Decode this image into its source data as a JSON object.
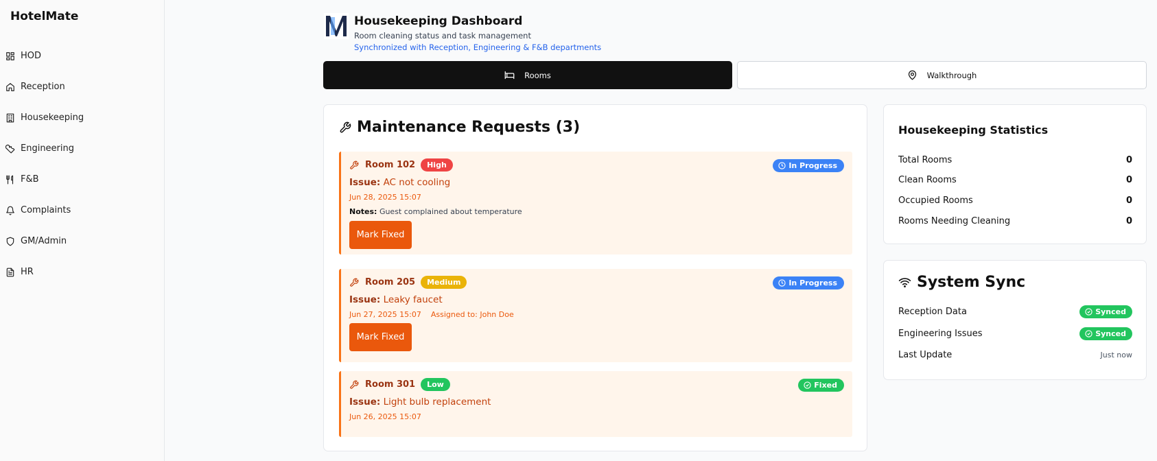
{
  "app": {
    "brand": "HotelMate"
  },
  "sidebar": {
    "items": [
      {
        "label": "HOD",
        "icon": "grid-icon"
      },
      {
        "label": "Reception",
        "icon": "home-icon"
      },
      {
        "label": "Housekeeping",
        "icon": "building-icon"
      },
      {
        "label": "Engineering",
        "icon": "wrench-icon"
      },
      {
        "label": "F&B",
        "icon": "utensils-icon"
      },
      {
        "label": "Complaints",
        "icon": "bell-icon"
      },
      {
        "label": "GM/Admin",
        "icon": "shield-icon"
      },
      {
        "label": "HR",
        "icon": "document-icon"
      }
    ]
  },
  "header": {
    "title": "Housekeeping Dashboard",
    "subtitle": "Room cleaning status and task management",
    "sync_note": "Synchronized with Reception, Engineering & F&B departments"
  },
  "tabs": [
    {
      "label": "Rooms",
      "icon": "bed-icon",
      "active": true
    },
    {
      "label": "Walkthrough",
      "icon": "map-pin-icon",
      "active": false
    }
  ],
  "maintenance": {
    "title": "Maintenance Requests (3)",
    "issue_label": "Issue:",
    "notes_label": "Notes:",
    "fix_label": "Mark Fixed",
    "requests": [
      {
        "room": "Room 102",
        "priority": "High",
        "priority_color": "#ef4444",
        "status": "In Progress",
        "status_color": "#3b82f6",
        "issue": "AC not cooling",
        "date": "Jun 28, 2025 15:07",
        "notes": "Guest complained about temperature"
      },
      {
        "room": "Room 205",
        "priority": "Medium",
        "priority_color": "#eab308",
        "status": "In Progress",
        "status_color": "#3b82f6",
        "issue": "Leaky faucet",
        "date": "Jun 27, 2025 15:07",
        "assigned": "Assigned to: John Doe"
      },
      {
        "room": "Room 301",
        "priority": "Low",
        "priority_color": "#22c55e",
        "status": "Fixed",
        "status_color": "#22c55e",
        "issue": "Light bulb replacement",
        "date": "Jun 26, 2025 15:07"
      }
    ]
  },
  "stats": {
    "title": "Housekeeping Statistics",
    "rows": [
      {
        "label": "Total Rooms",
        "value": "0"
      },
      {
        "label": "Clean Rooms",
        "value": "0"
      },
      {
        "label": "Occupied Rooms",
        "value": "0"
      },
      {
        "label": "Rooms Needing Cleaning",
        "value": "0"
      }
    ]
  },
  "system_sync": {
    "title": "System Sync",
    "rows": [
      {
        "label": "Reception Data",
        "value": "Synced"
      },
      {
        "label": "Engineering Issues",
        "value": "Synced"
      },
      {
        "label": "Last Update",
        "value": "Just now"
      }
    ]
  }
}
